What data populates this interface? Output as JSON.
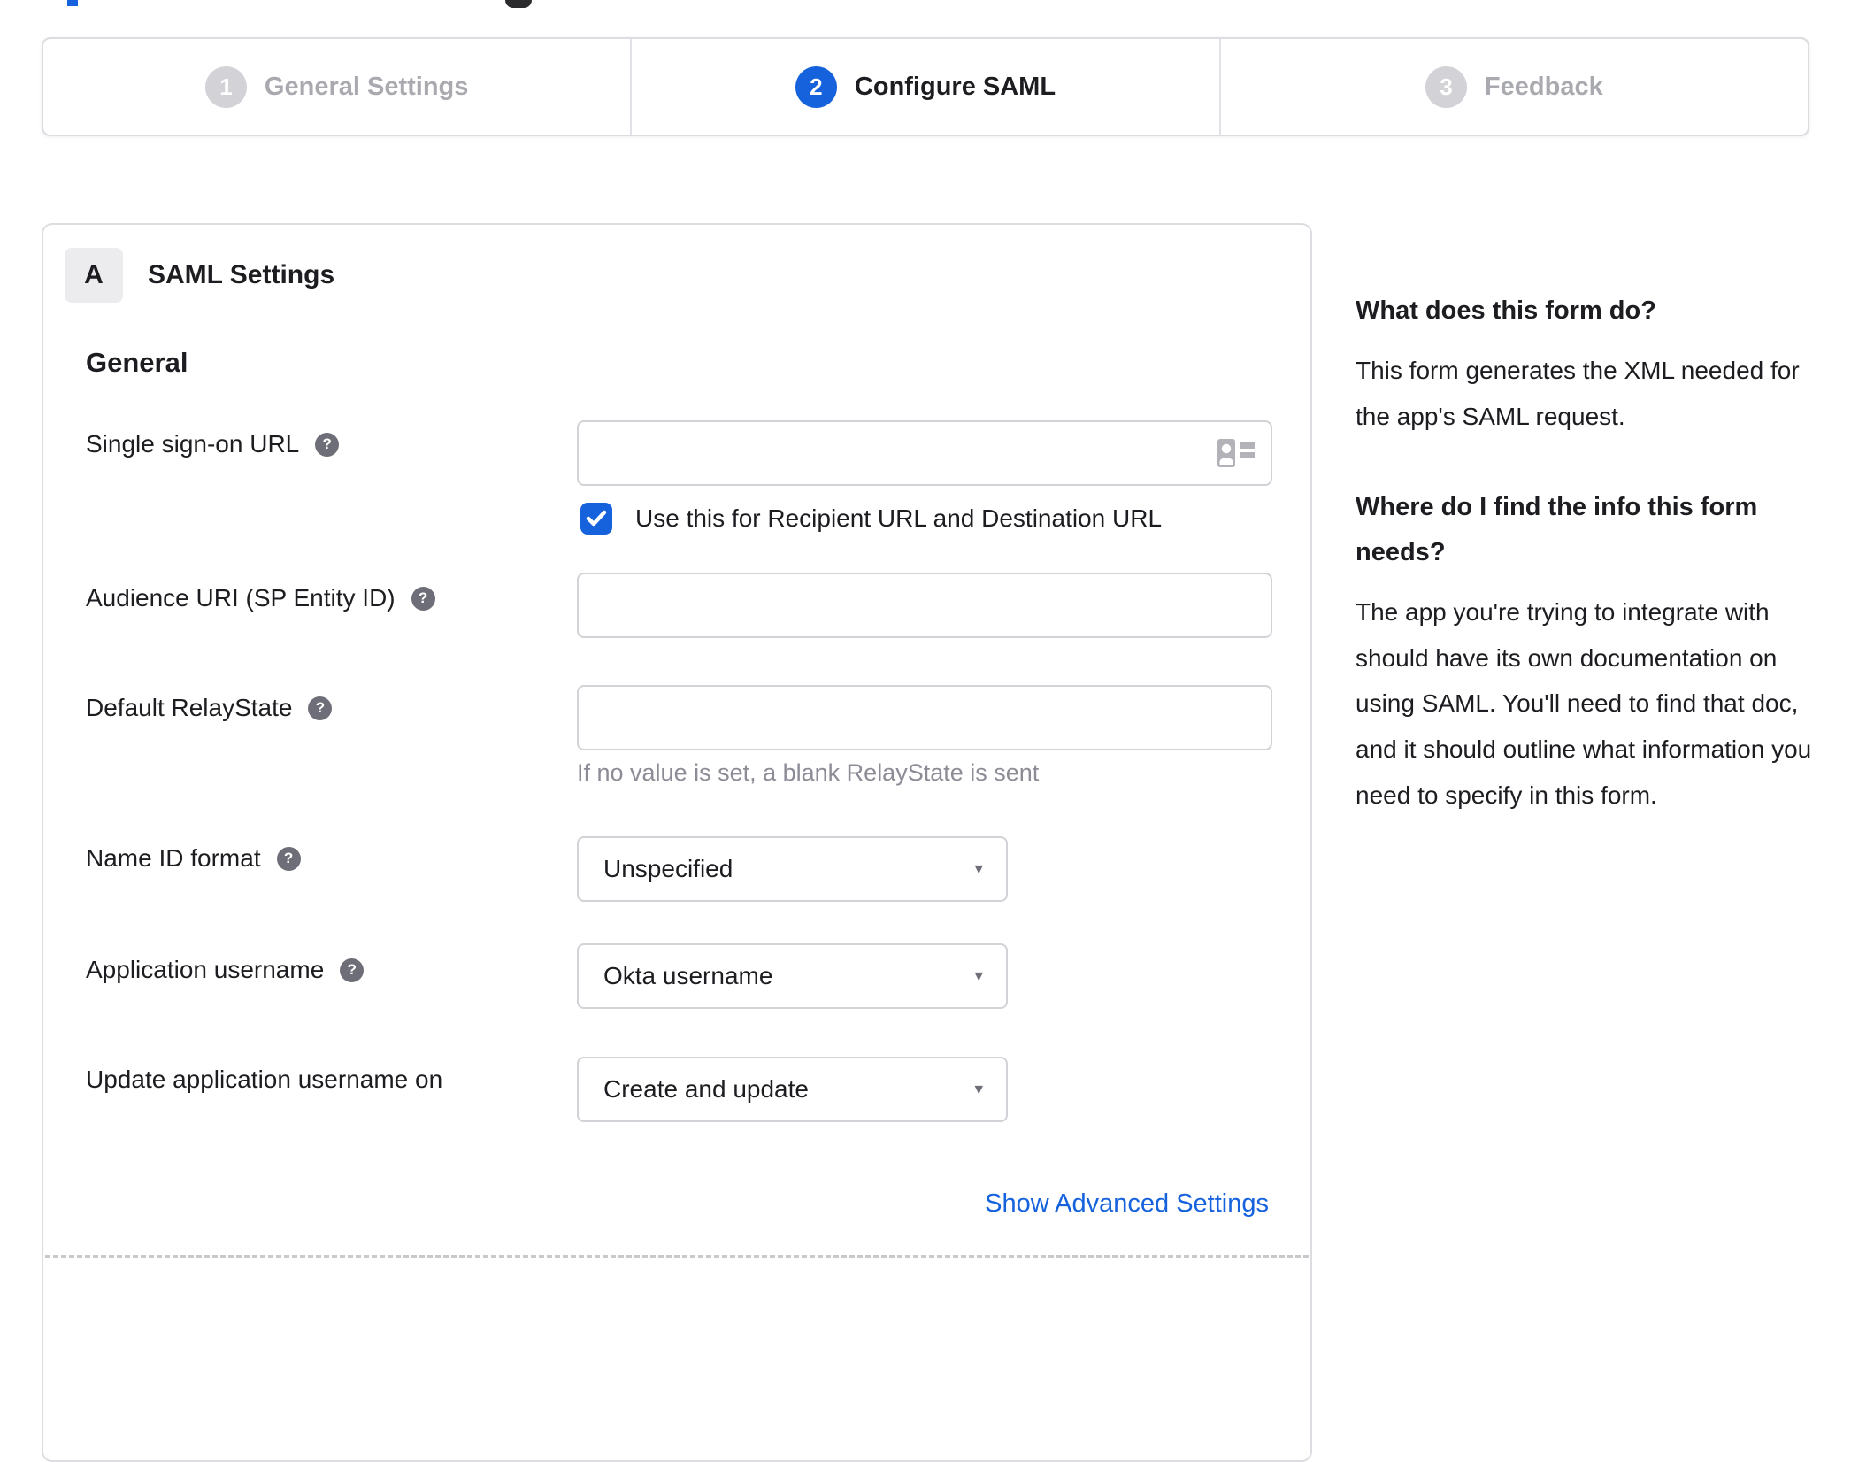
{
  "colors": {
    "accent_blue": "#1662dd",
    "text_dark": "#1d1d21",
    "inactive_gray": "#a9a9b0",
    "border_gray": "#dcdce1",
    "hint_gray": "#8c8c96"
  },
  "icons": {
    "help_glyph": "?",
    "dropdown_arrow": "▾"
  },
  "stepper": {
    "steps": [
      {
        "number": "1",
        "label": "General Settings",
        "active": false
      },
      {
        "number": "2",
        "label": "Configure SAML",
        "active": true
      },
      {
        "number": "3",
        "label": "Feedback",
        "active": false
      }
    ]
  },
  "panel": {
    "badge": "A",
    "title": "SAML Settings",
    "section_heading": "General",
    "sso_url": {
      "label": "Single sign-on URL",
      "value": "",
      "checkbox_label": "Use this for Recipient URL and Destination URL",
      "checkbox_checked": true
    },
    "audience_uri": {
      "label": "Audience URI (SP Entity ID)",
      "value": ""
    },
    "default_relay_state": {
      "label": "Default RelayState",
      "value": "",
      "hint": "If no value is set, a blank RelayState is sent"
    },
    "name_id_format": {
      "label": "Name ID format",
      "value": "Unspecified"
    },
    "application_username": {
      "label": "Application username",
      "value": "Okta username"
    },
    "update_application_username_on": {
      "label": "Update application username on",
      "value": "Create and update"
    },
    "advanced_settings_link": "Show Advanced Settings"
  },
  "sidebar": {
    "sections": [
      {
        "heading": "What does this form do?",
        "body": "This form generates the XML needed for the app's SAML request."
      },
      {
        "heading": "Where do I find the info this form needs?",
        "body": "The app you're trying to integrate with should have its own documentation on using SAML. You'll need to find that doc, and it should outline what information you need to specify in this form."
      }
    ]
  }
}
